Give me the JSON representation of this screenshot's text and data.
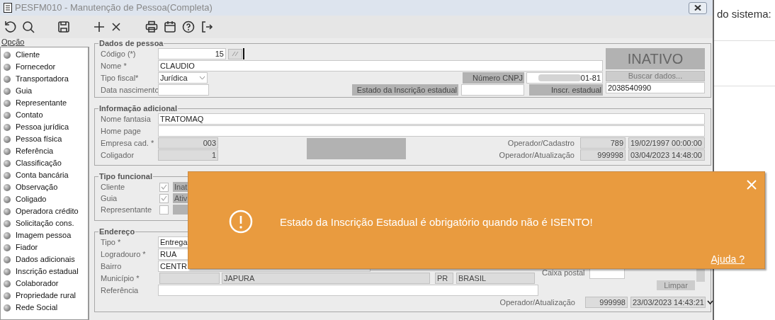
{
  "window": {
    "title": "PESFM010 - Manutenção de Pessoa(Completa)"
  },
  "background_page": {
    "text": "do sistema:"
  },
  "sidebar": {
    "heading": "Opção",
    "items": [
      "Cliente",
      "Fornecedor",
      "Transportadora",
      "Guia",
      "Representante",
      "Contato",
      "Pessoa jurídica",
      "Pessoa física",
      "Referência",
      "Classificação",
      "Conta bancária",
      "Observação",
      "Coligado",
      "Operadora crédito",
      "Solicitação cons.",
      "Imagem pessoa",
      "Fiador",
      "Dados adicionais",
      "Inscrição estadual",
      "Colaborador",
      "Propriedade rural",
      "Rede Social"
    ]
  },
  "dados_de_pessoa": {
    "title": "Dados de pessoa",
    "codigo": {
      "label": "Código (*)",
      "value": "15"
    },
    "nome": {
      "label": "Nome *",
      "value": "CLAUDIO"
    },
    "tipo_fiscal": {
      "label": "Tipo fiscal*",
      "value": "Jurídica"
    },
    "data_nascimento": {
      "label": "Data nascimento"
    },
    "status": "INATIVO",
    "cnpj": {
      "label": "Número CNPJ",
      "value": "01-81"
    },
    "buscar_button": "Buscar dados...",
    "estado_inscricao": {
      "label": "Estado da Inscrição estadual"
    },
    "inscr_estadual": {
      "label": "Inscr. estadual",
      "value": "2038540990"
    }
  },
  "informacao_adicional": {
    "title": "Informação adicional",
    "nome_fantasia": {
      "label": "Nome fantasia",
      "value": "TRATOMAQ"
    },
    "home_page": {
      "label": "Home page"
    },
    "empresa_cad": {
      "label": "Empresa cad. *",
      "value": "003"
    },
    "coligador": {
      "label": "Coligador",
      "value": "1"
    },
    "operadores": [
      {
        "label": "Operador/Cadastro",
        "code": "789",
        "date": "19/02/1997 00:00:00"
      },
      {
        "label": "Operador/Atualização",
        "code": "999998",
        "date": "03/04/2023 14:48:00"
      }
    ]
  },
  "tipo_funcional": {
    "title": "Tipo funcional",
    "items": [
      {
        "label": "Cliente",
        "checked": true,
        "status": "Inat"
      },
      {
        "label": "Guia",
        "checked": true,
        "status": "Ativ"
      },
      {
        "label": "Representante",
        "checked": false
      }
    ]
  },
  "endereco": {
    "title": "Endereço",
    "tipo": {
      "label": "Tipo *",
      "value": "Entrega"
    },
    "logradouro": {
      "label": "Logradouro *",
      "value": "RUA"
    },
    "bairro": {
      "label": "Bairro",
      "value": "CENTR"
    },
    "municipio": {
      "label": "Município *",
      "name": "JAPURA",
      "uf": "PR",
      "pais": "BRASIL"
    },
    "referencia": {
      "label": "Referência"
    },
    "caixa_postal": {
      "label": "Caixa postal"
    },
    "limpar_button": "Limpar",
    "operador_atualizacao": {
      "label": "Operador/Atualização",
      "code": "999998",
      "date": "23/03/2023 14:43:21"
    }
  },
  "toast": {
    "message": "Estado da Inscrição Estadual é obrigatório quando não é ISENTO!",
    "help_link": "Ajuda ?"
  }
}
